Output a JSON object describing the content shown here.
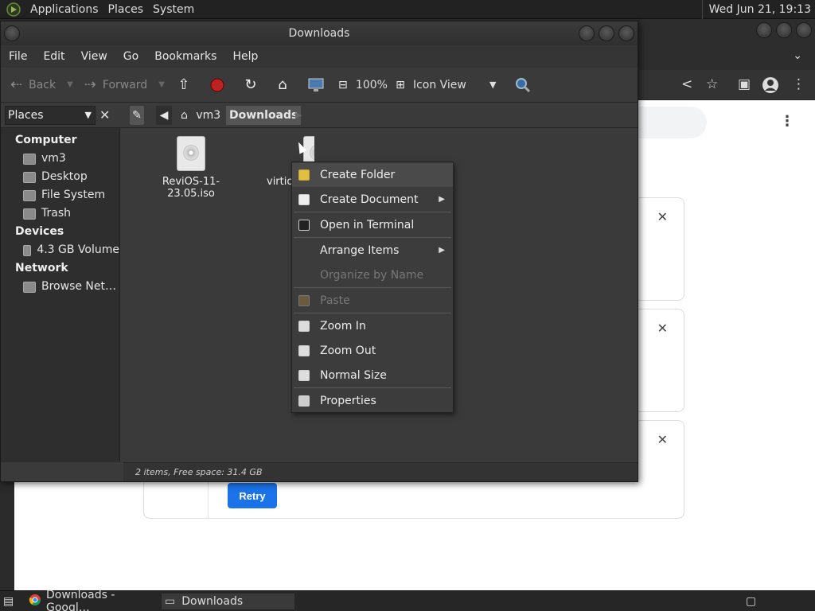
{
  "top_panel": {
    "menus": [
      "Applications",
      "Places",
      "System"
    ],
    "clock": "Wed Jun 21, 19:13"
  },
  "file_manager": {
    "title": "Downloads",
    "menubar": [
      "File",
      "Edit",
      "View",
      "Go",
      "Bookmarks",
      "Help"
    ],
    "toolbar": {
      "back_label": "Back",
      "forward_label": "Forward",
      "zoom_level": "100%",
      "view_mode": "Icon View"
    },
    "location": {
      "sidebar_selector": "Places",
      "crumbs": [
        "vm3",
        "Downloads"
      ]
    },
    "sidebar": {
      "computer_heading": "Computer",
      "computer_items": [
        "vm3",
        "Desktop",
        "File System",
        "Trash"
      ],
      "devices_heading": "Devices",
      "devices_items": [
        "4.3 GB Volume"
      ],
      "network_heading": "Network",
      "network_items": [
        "Browse Net…"
      ]
    },
    "files": [
      "ReviOS-11-23.05.iso",
      "virtio"
    ],
    "status": "2 items, Free space: 31.4 GB"
  },
  "context_menu": {
    "items": [
      "Create Folder",
      "Create Document",
      "Open in Terminal",
      "Arrange Items",
      "Organize by Name",
      "Paste",
      "Zoom In",
      "Zoom Out",
      "Normal Size",
      "Properties"
    ]
  },
  "browser": {
    "retry_label": "Retry"
  },
  "taskbar": {
    "tasks": [
      "Downloads - Googl…",
      "Downloads"
    ]
  }
}
